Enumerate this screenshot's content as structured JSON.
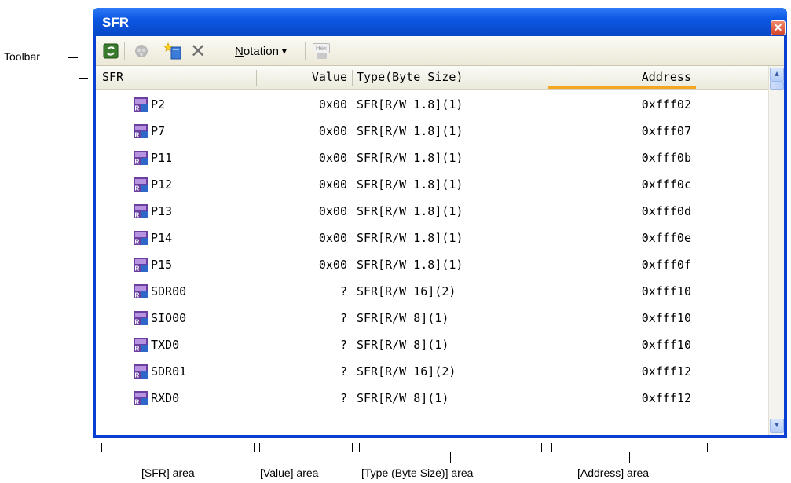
{
  "annotations": {
    "toolbar_label": "Toolbar",
    "sfr_area": "[SFR] area",
    "value_area": "[Value] area",
    "type_area": "[Type (Byte Size)] area",
    "address_area": "[Address] area"
  },
  "window": {
    "title": "SFR",
    "close_glyph": "✕"
  },
  "toolbar": {
    "refresh_icon": "refresh-icon",
    "watch_icon": "watch-icon",
    "new_category_icon": "new-category-icon",
    "delete_glyph": "✕",
    "notation_label": "Notation",
    "notation_arrow": "▾",
    "hex_label": "Hex"
  },
  "columns": {
    "sfr": "SFR",
    "value": "Value",
    "type": "Type(Byte Size)",
    "address": "Address"
  },
  "rows": [
    {
      "name": "P2",
      "value": "0x00",
      "type": "SFR[R/W 1.8](1)",
      "address": "0xfff02"
    },
    {
      "name": "P7",
      "value": "0x00",
      "type": "SFR[R/W 1.8](1)",
      "address": "0xfff07"
    },
    {
      "name": "P11",
      "value": "0x00",
      "type": "SFR[R/W 1.8](1)",
      "address": "0xfff0b"
    },
    {
      "name": "P12",
      "value": "0x00",
      "type": "SFR[R/W 1.8](1)",
      "address": "0xfff0c"
    },
    {
      "name": "P13",
      "value": "0x00",
      "type": "SFR[R/W 1.8](1)",
      "address": "0xfff0d"
    },
    {
      "name": "P14",
      "value": "0x00",
      "type": "SFR[R/W 1.8](1)",
      "address": "0xfff0e"
    },
    {
      "name": "P15",
      "value": "0x00",
      "type": "SFR[R/W 1.8](1)",
      "address": "0xfff0f"
    },
    {
      "name": "SDR00",
      "value": "?",
      "type": "SFR[R/W 16](2)",
      "address": "0xfff10"
    },
    {
      "name": "SIO00",
      "value": "?",
      "type": "SFR[R/W 8](1)",
      "address": "0xfff10"
    },
    {
      "name": "TXD0",
      "value": "?",
      "type": "SFR[R/W 8](1)",
      "address": "0xfff10"
    },
    {
      "name": "SDR01",
      "value": "?",
      "type": "SFR[R/W 16](2)",
      "address": "0xfff12"
    },
    {
      "name": "RXD0",
      "value": "?",
      "type": "SFR[R/W 8](1)",
      "address": "0xfff12"
    }
  ],
  "scrollbar": {
    "up_glyph": "▲",
    "down_glyph": "▼"
  },
  "colors": {
    "titlebar": "#0b57e3",
    "sort_accent": "#f5a623",
    "icon_purple": "#6a3fa0",
    "icon_blue": "#2f67c8"
  }
}
